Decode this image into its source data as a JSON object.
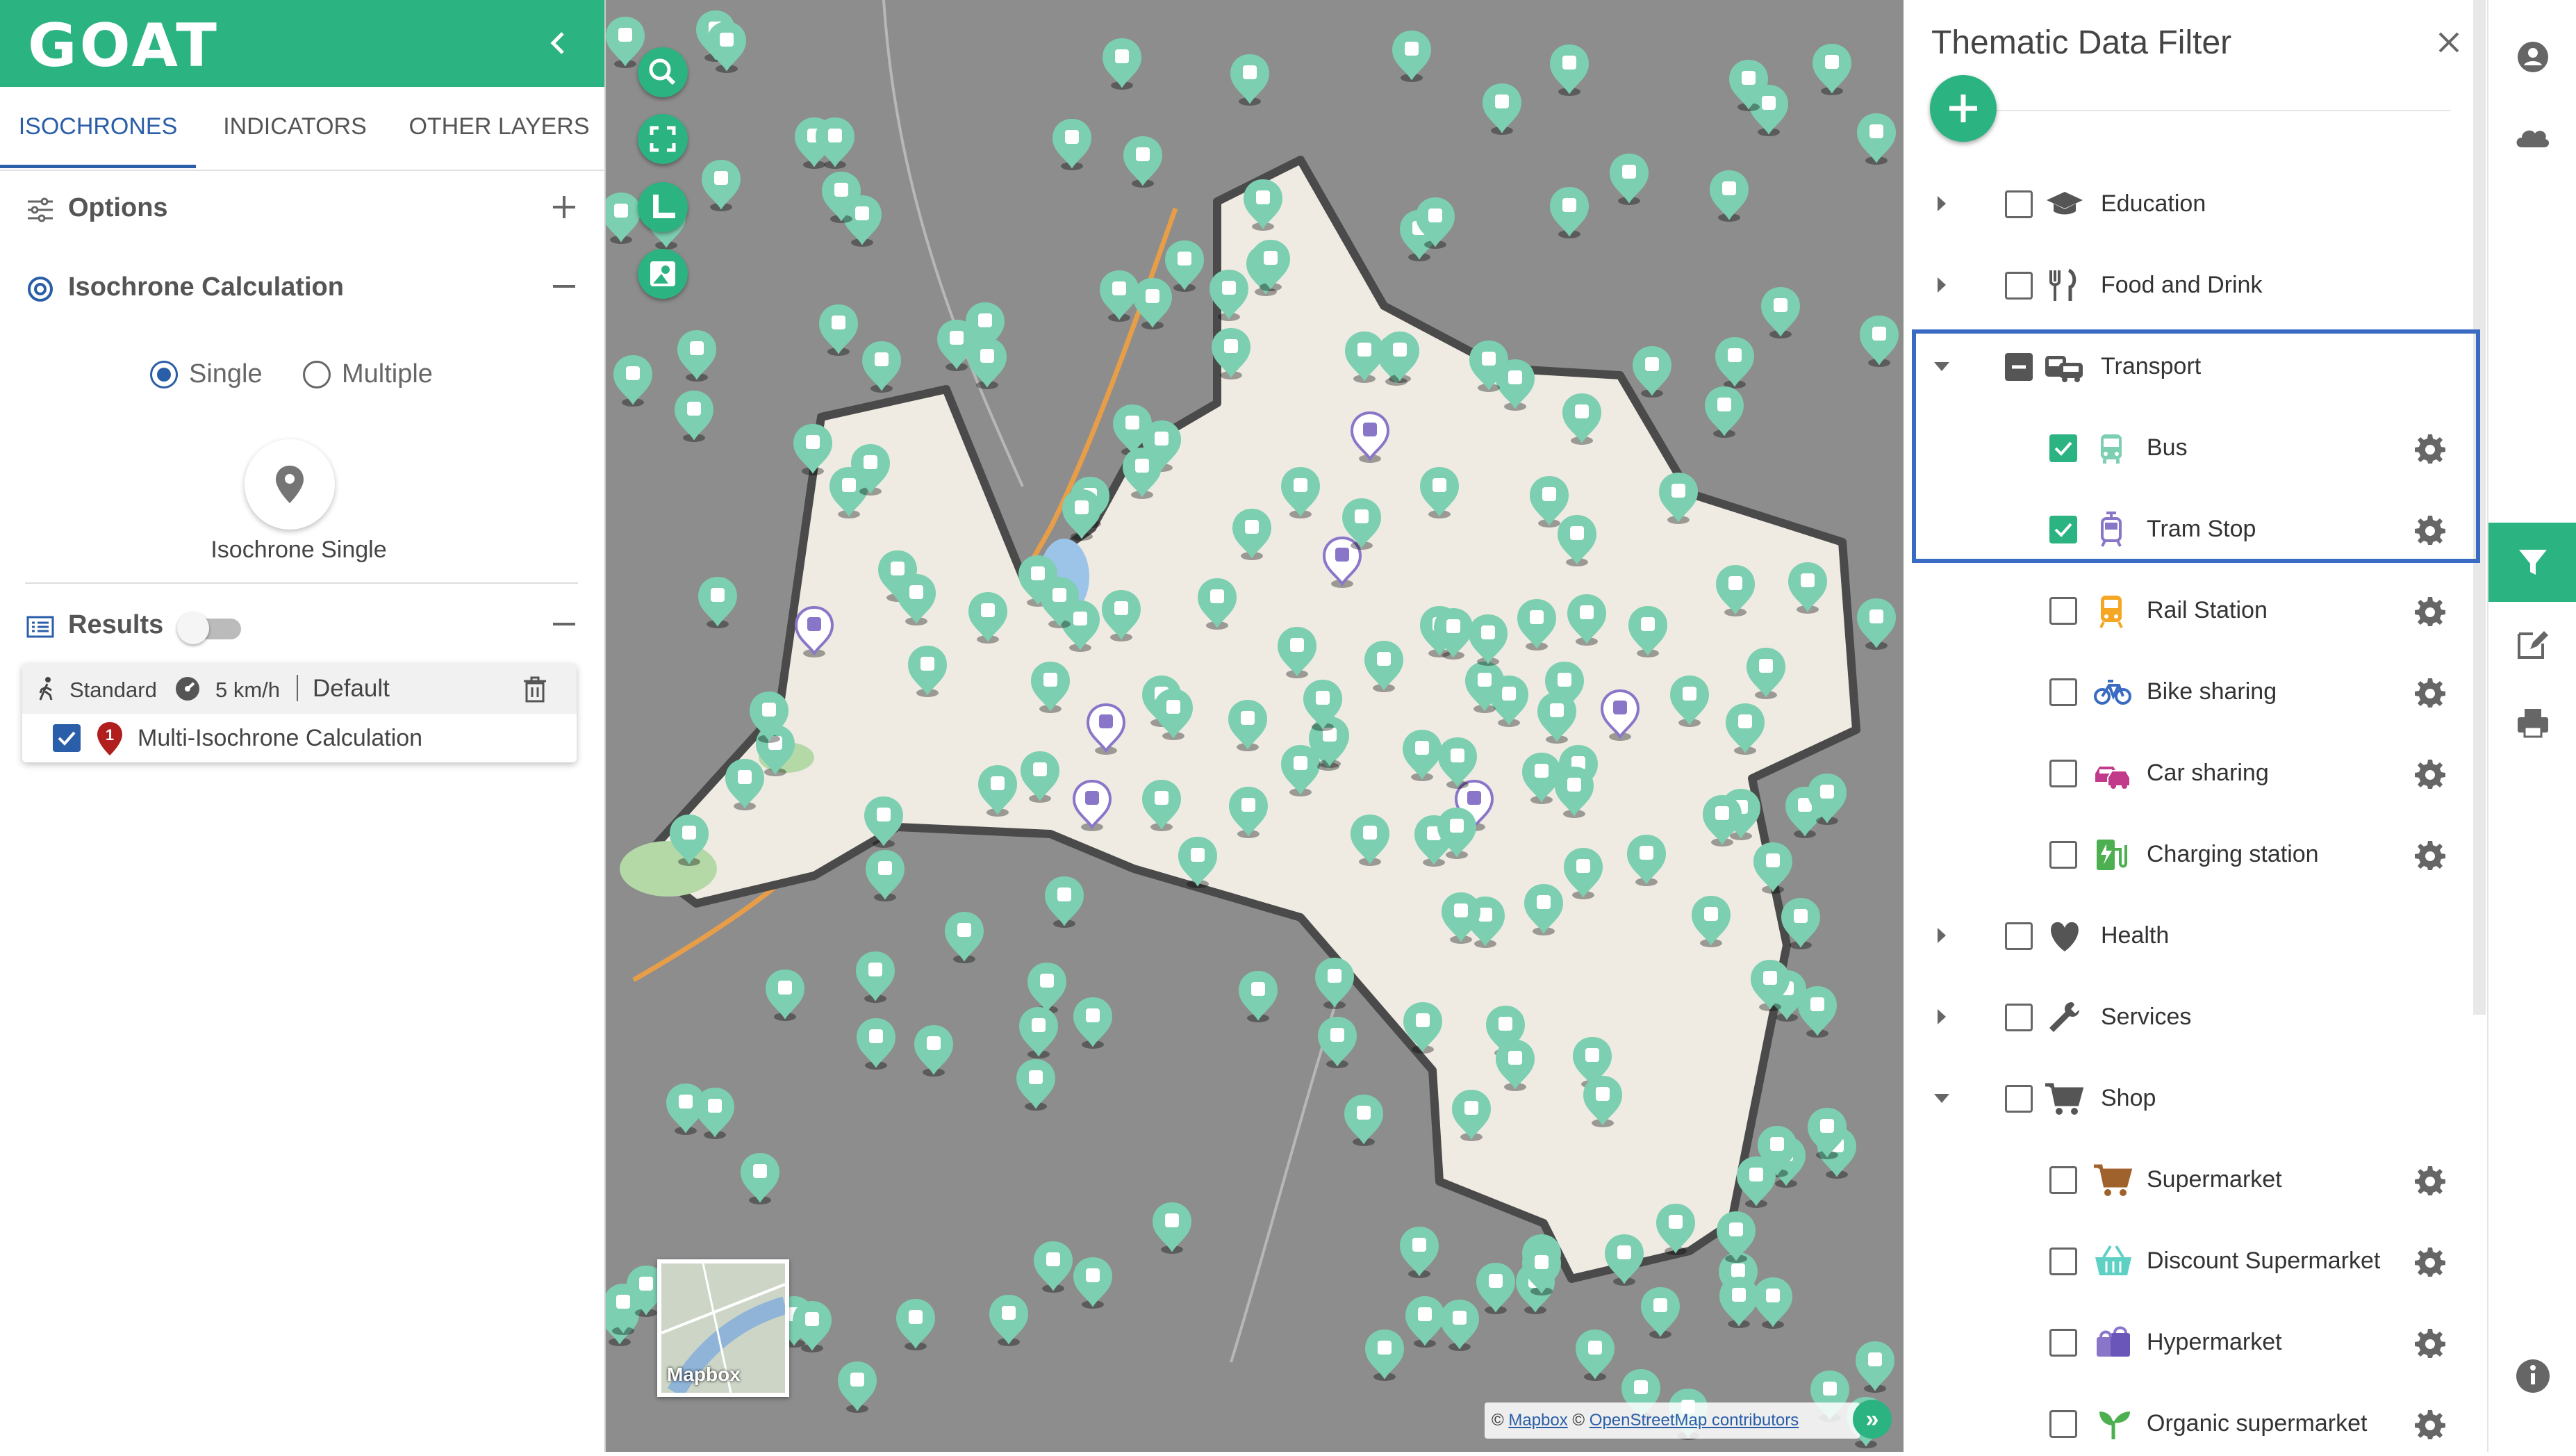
{
  "app": {
    "logo": "GOAT"
  },
  "left": {
    "tabs": [
      "ISOCHRONES",
      "INDICATORS",
      "OTHER LAYERS"
    ],
    "options_label": "Options",
    "isochrone_calc_label": "Isochrone Calculation",
    "radio_single": "Single",
    "radio_multiple": "Multiple",
    "iso_single_label": "Isochrone Single",
    "results_label": "Results",
    "result_card": {
      "mode": "Standard",
      "speed": "5 km/h",
      "profile": "Default",
      "item_label": "Multi-Isochrone Calculation",
      "item_number": "1"
    }
  },
  "map": {
    "thumb_label": "Mapbox",
    "attr_mapbox": "Mapbox",
    "attr_osm": "OpenStreetMap contributors",
    "attr_copy": "©",
    "toggle": "»",
    "colors": {
      "bus": "#7CCFB0",
      "tram": "#8A76C8",
      "isochrone": "#EFEBE3",
      "outline": "#4a4a4a"
    }
  },
  "filter": {
    "title": "Thematic Data Filter",
    "add": "+",
    "categories": [
      {
        "label": "Education",
        "icon": "graduation-cap-icon",
        "state": "unchecked",
        "arrow": "collapsed"
      },
      {
        "label": "Food and Drink",
        "icon": "fork-knife-icon",
        "state": "unchecked",
        "arrow": "collapsed"
      },
      {
        "label": "Transport",
        "icon": "vehicles-icon",
        "state": "indeterminate",
        "arrow": "expanded"
      },
      {
        "label": "Bus",
        "icon": "bus-icon",
        "state": "checked",
        "child": true
      },
      {
        "label": "Tram Stop",
        "icon": "tram-icon",
        "state": "checked",
        "child": true
      },
      {
        "label": "Rail Station",
        "icon": "train-icon",
        "state": "unchecked",
        "child": true
      },
      {
        "label": "Bike sharing",
        "icon": "bike-icon",
        "state": "unchecked",
        "child": true
      },
      {
        "label": "Car sharing",
        "icon": "car-sharing-icon",
        "state": "unchecked",
        "child": true
      },
      {
        "label": "Charging station",
        "icon": "charging-station-icon",
        "state": "unchecked",
        "child": true
      },
      {
        "label": "Health",
        "icon": "heart-icon",
        "state": "unchecked",
        "arrow": "collapsed"
      },
      {
        "label": "Services",
        "icon": "wrench-icon",
        "state": "unchecked",
        "arrow": "collapsed"
      },
      {
        "label": "Shop",
        "icon": "cart-icon",
        "state": "unchecked",
        "arrow": "expanded"
      },
      {
        "label": "Supermarket",
        "icon": "shopping-cart-icon",
        "state": "unchecked",
        "child": true
      },
      {
        "label": "Discount Supermarket",
        "icon": "basket-icon",
        "state": "unchecked",
        "child": true
      },
      {
        "label": "Hypermarket",
        "icon": "bags-icon",
        "state": "unchecked",
        "child": true
      },
      {
        "label": "Organic supermarket",
        "icon": "sprout-icon",
        "state": "unchecked",
        "child": true
      }
    ]
  }
}
